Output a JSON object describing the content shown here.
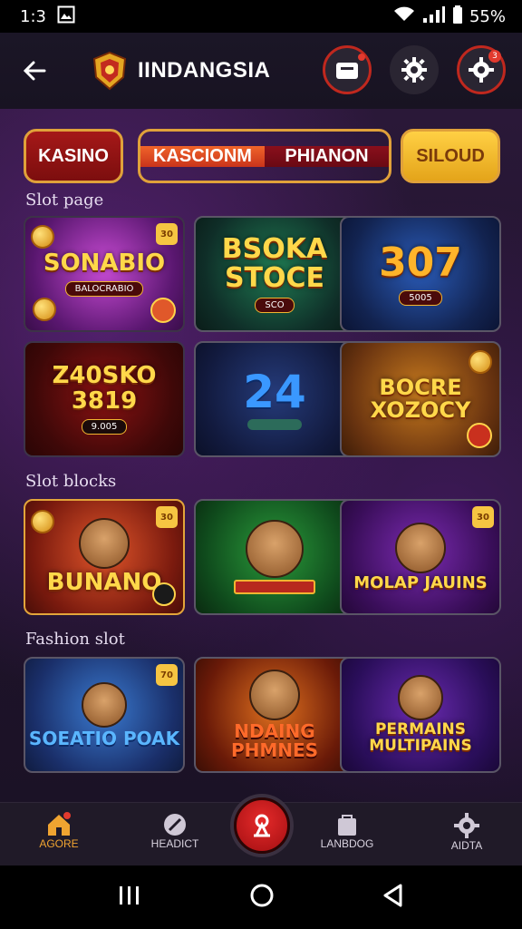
{
  "status_bar": {
    "time": "1:3",
    "battery_text": "55%",
    "icons": [
      "gallery-icon",
      "wifi-icon",
      "signal-icon",
      "battery-icon"
    ]
  },
  "header": {
    "brand": "IINDANGSIA",
    "actions": [
      "wallet-icon",
      "settings-icon",
      "notification-settings-icon"
    ],
    "notif_count": "3"
  },
  "tabs": {
    "kasino": "KASINO",
    "group_a": "KASCIONM",
    "group_b": "PHIANON",
    "slot": "SILOUD"
  },
  "sections": {
    "slot_page": "Slot page",
    "slot_blocks": "Slot blocks",
    "fashion_slot": "Fashion slot"
  },
  "cards": {
    "row1": [
      {
        "title": "SONABIO",
        "sub": "BALOCRABIO",
        "tag": "30"
      },
      {
        "title": "BSOKA STOCE",
        "sub": "SCO"
      },
      {
        "title": "307",
        "sub": "5005"
      }
    ],
    "row2": [
      {
        "title": "Z40SKO 3819",
        "sub": "9.005"
      },
      {
        "title": "24",
        "sub": ""
      },
      {
        "title": "BOCRE XOZOCY",
        "sub": ""
      }
    ],
    "row3": [
      {
        "title": "BUNANO",
        "tag": "30"
      },
      {
        "title": ""
      },
      {
        "title": "MOLAP JAUINS",
        "tag": "30"
      }
    ],
    "row4": [
      {
        "title": "SOEATIO POAK",
        "tag": "70"
      },
      {
        "title": "NDAING PHMNES"
      },
      {
        "title": "PERMAINS MULTIPAINS"
      }
    ]
  },
  "bottom_nav": {
    "home": "AGORE",
    "feed": "HEADICT",
    "lanbog": "LANBDOG",
    "akta": "AIDTA"
  },
  "colors": {
    "accent": "#f0a431",
    "red": "#c0281e",
    "gold": "#f6c542"
  }
}
